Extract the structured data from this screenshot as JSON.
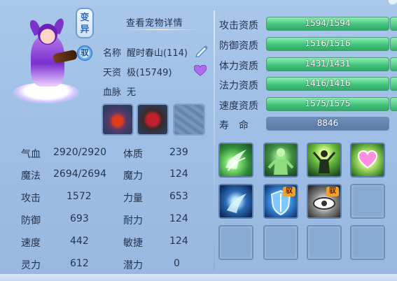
{
  "pet": {
    "transform_badge": "变异",
    "ride_badge": "驭",
    "detail_link": "查看宠物详情",
    "name_label": "名称",
    "name_value": "醒时春山(114)",
    "aptitude_label": "天资",
    "aptitude_value": "极(15749)",
    "bloodline_label": "血脉",
    "bloodline_value": "无"
  },
  "stats": [
    {
      "label": "气血",
      "value": "2920/2920"
    },
    {
      "label": "魔法",
      "value": "2694/2694"
    },
    {
      "label": "攻击",
      "value": "1572"
    },
    {
      "label": "防御",
      "value": "693"
    },
    {
      "label": "速度",
      "value": "442"
    },
    {
      "label": "灵力",
      "value": "612"
    }
  ],
  "attributes": [
    {
      "label": "体质",
      "value": "239"
    },
    {
      "label": "魔力",
      "value": "124"
    },
    {
      "label": "力量",
      "value": "653"
    },
    {
      "label": "耐力",
      "value": "124"
    },
    {
      "label": "敏捷",
      "value": "124"
    },
    {
      "label": "潜力",
      "value": "0"
    }
  ],
  "qualities": [
    {
      "label": "攻击资质",
      "value": "1594/1594",
      "fill": 1.0
    },
    {
      "label": "防御资质",
      "value": "1516/1516",
      "fill": 1.0
    },
    {
      "label": "体力资质",
      "value": "1431/1431",
      "fill": 1.0
    },
    {
      "label": "法力资质",
      "value": "1416/1416",
      "fill": 1.0
    },
    {
      "label": "速度资质",
      "value": "1575/1575",
      "fill": 1.0
    }
  ],
  "lifespan": {
    "label": "寿　命",
    "value": "8846"
  },
  "skills": [
    {
      "icon": "wing-skill-icon",
      "badge": ""
    },
    {
      "icon": "spirit-body-skill-icon",
      "badge": ""
    },
    {
      "icon": "warrior-skill-icon",
      "badge": ""
    },
    {
      "icon": "heart-skill-icon",
      "badge": ""
    },
    {
      "icon": "ice-claw-skill-icon",
      "badge": ""
    },
    {
      "icon": "shield-skill-icon",
      "badge": "驭"
    },
    {
      "icon": "eye-skill-icon",
      "badge": "驭"
    }
  ],
  "colors": {
    "bar_green": "#42c47c",
    "panel_bg": "#a9c7ea",
    "text": "#23344e"
  }
}
